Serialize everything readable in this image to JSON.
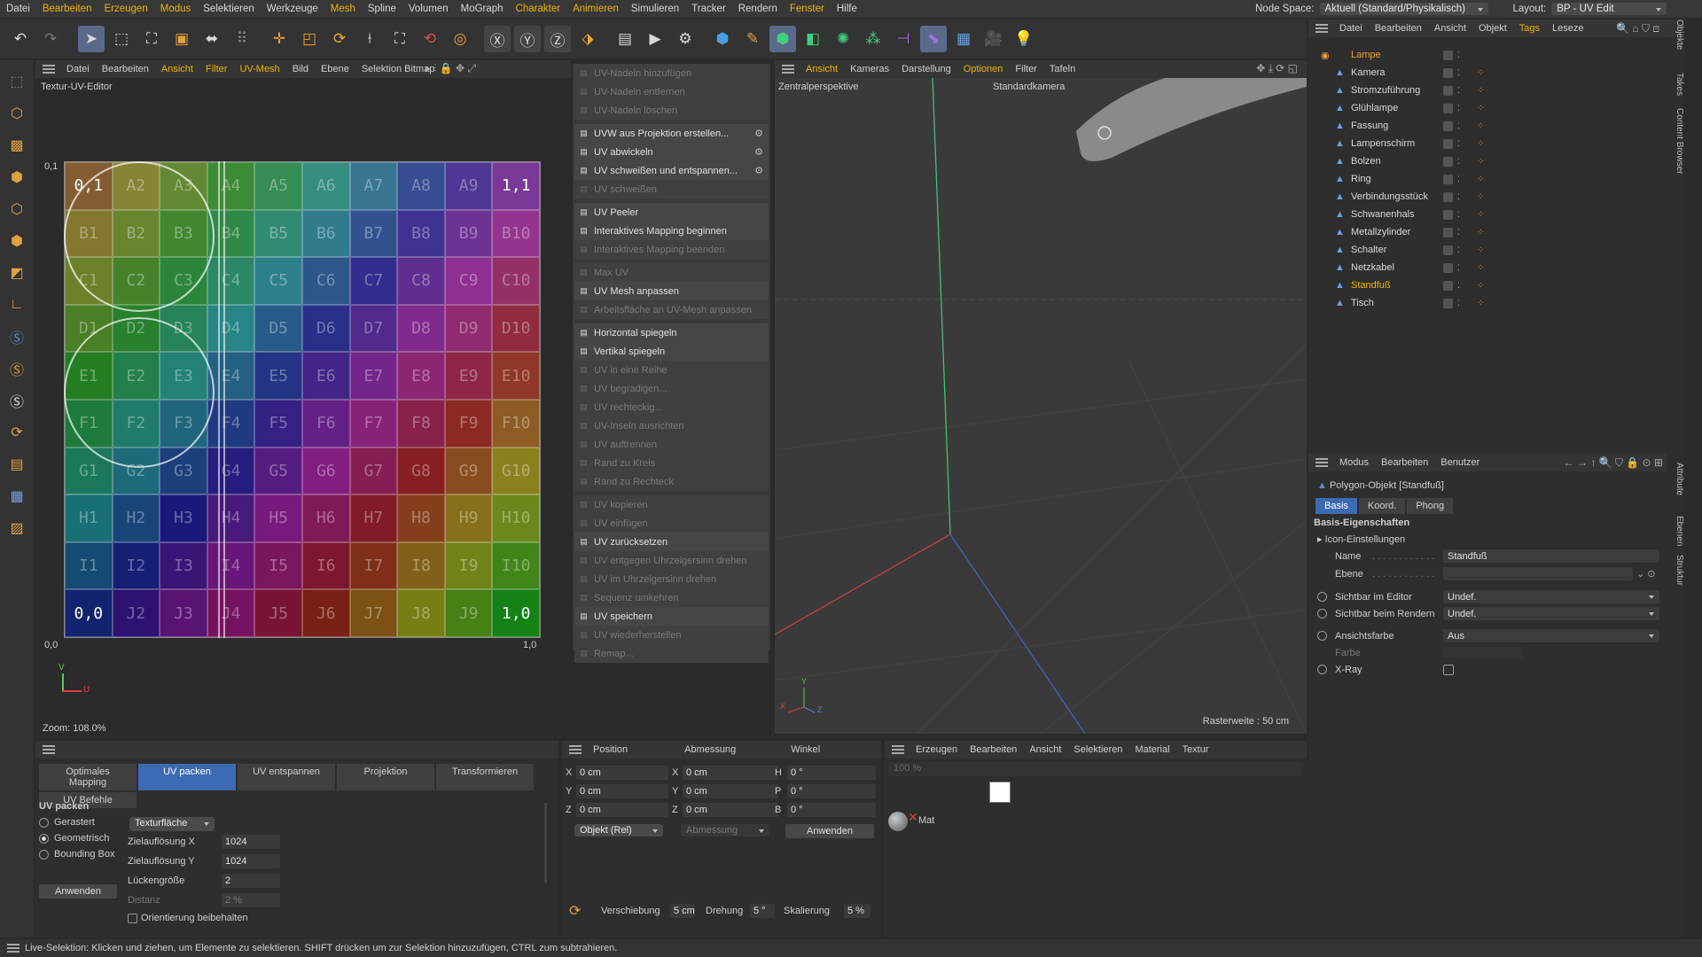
{
  "menubar": {
    "items": [
      "Datei",
      "Bearbeiten",
      "Erzeugen",
      "Modus",
      "Selektieren",
      "Werkzeuge",
      "Mesh",
      "Spline",
      "Volumen",
      "MoGraph",
      "Charakter",
      "Animieren",
      "Simulieren",
      "Tracker",
      "Rendern",
      "Fenster",
      "Hilfe"
    ],
    "highlight": [
      "Bearbeiten",
      "Erzeugen",
      "Modus",
      "Mesh",
      "Charakter",
      "Animieren",
      "Fenster"
    ],
    "node_space_label": "Node Space:",
    "node_space_value": "Aktuell (Standard/Physikalisch)",
    "layout_label": "Layout:",
    "layout_value": "BP - UV Edit"
  },
  "uv_editor": {
    "menu": [
      "Datei",
      "Bearbeiten",
      "Ansicht",
      "Filter",
      "UV-Mesh",
      "Bild",
      "Ebene",
      "Selektion Bitmap"
    ],
    "menu_hl": [
      "Ansicht",
      "Filter",
      "UV-Mesh"
    ],
    "title": "Textur-UV-Editor",
    "corner_tl": "0,1",
    "corner_bl": "0,0",
    "corner_br": "1,0",
    "corner_tr": "1,1",
    "zoom": "Zoom: 108.0%",
    "cells": [
      "0,1",
      "A2",
      "A3",
      "A4",
      "A5",
      "A6",
      "A7",
      "A8",
      "A9",
      "1,1",
      "B1",
      "B2",
      "B3",
      "B4",
      "B5",
      "B6",
      "B7",
      "B8",
      "B9",
      "B10",
      "C1",
      "C2",
      "C3",
      "C4",
      "C5",
      "C6",
      "C7",
      "C8",
      "C9",
      "C10",
      "D1",
      "D2",
      "D3",
      "D4",
      "D5",
      "D6",
      "D7",
      "D8",
      "D9",
      "D10",
      "E1",
      "E2",
      "E3",
      "E4",
      "E5",
      "E6",
      "E7",
      "E8",
      "E9",
      "E10",
      "F1",
      "F2",
      "F3",
      "F4",
      "F5",
      "F6",
      "F7",
      "F8",
      "F9",
      "F10",
      "G1",
      "G2",
      "G3",
      "G4",
      "G5",
      "G6",
      "G7",
      "G8",
      "G9",
      "G10",
      "H1",
      "H2",
      "H3",
      "H4",
      "H5",
      "H6",
      "H7",
      "H8",
      "H9",
      "H10",
      "I1",
      "I2",
      "I3",
      "I4",
      "I5",
      "I6",
      "I7",
      "I8",
      "I9",
      "I10",
      "0,0",
      "J2",
      "J3",
      "J4",
      "J5",
      "J6",
      "J7",
      "J8",
      "J9",
      "1,0"
    ]
  },
  "uv_commands": [
    {
      "label": "UV-Nadeln hinzufügen",
      "dis": true
    },
    {
      "label": "UV-Nadeln entfernen",
      "dis": true
    },
    {
      "label": "UV-Nadeln löschen",
      "dis": true
    },
    {
      "sep": true
    },
    {
      "label": "UVW aus Projektion erstellen...",
      "dis": false,
      "gear": true
    },
    {
      "label": "UV abwickeln",
      "dis": false,
      "gear": true
    },
    {
      "label": "UV schweißen und entspannen...",
      "dis": false,
      "gear": true
    },
    {
      "label": "UV schweißen",
      "dis": true
    },
    {
      "sep": true
    },
    {
      "label": "UV Peeler",
      "dis": false
    },
    {
      "label": "Interaktives Mapping beginnen",
      "dis": false
    },
    {
      "label": "Interaktives Mapping beenden",
      "dis": true
    },
    {
      "sep": true
    },
    {
      "label": "Max UV",
      "dis": true
    },
    {
      "label": "UV Mesh anpassen",
      "dis": false
    },
    {
      "label": "Arbeitsfläche an UV-Mesh anpassen",
      "dis": true
    },
    {
      "sep": true
    },
    {
      "label": "Horizontal spiegeln",
      "dis": false
    },
    {
      "label": "Vertikal spiegeln",
      "dis": false
    },
    {
      "label": "UV in eine Reihe",
      "dis": true
    },
    {
      "label": "UV begradigen...",
      "dis": true
    },
    {
      "label": "UV rechteckig...",
      "dis": true
    },
    {
      "label": "UV-Inseln ausrichten",
      "dis": true
    },
    {
      "label": "UV auftrennen",
      "dis": true
    },
    {
      "label": "Rand zu Kreis",
      "dis": true
    },
    {
      "label": "Rand zu Rechteck",
      "dis": true
    },
    {
      "sep": true
    },
    {
      "label": "UV kopieren",
      "dis": true
    },
    {
      "label": "UV einfügen",
      "dis": true
    },
    {
      "label": "UV zurücksetzen",
      "dis": false
    },
    {
      "label": "UV entgegen Uhrzeigersinn drehen",
      "dis": true
    },
    {
      "label": "UV im Uhrzeigersinn drehen",
      "dis": true
    },
    {
      "label": "Sequenz umkehren",
      "dis": true
    },
    {
      "label": "UV speichern",
      "dis": false
    },
    {
      "label": "UV wiederherstellen",
      "dis": true
    },
    {
      "label": "Remap...",
      "dis": true
    }
  ],
  "viewport": {
    "menu": [
      "Ansicht",
      "Kameras",
      "Darstellung",
      "Optionen",
      "Filter",
      "Tafeln"
    ],
    "menu_hl": [
      "Ansicht",
      "Optionen"
    ],
    "perspective": "Zentralperspektive",
    "camera": "Standardkamera",
    "grid": "Rasterweite : 50 cm",
    "axis_x": "X",
    "axis_y": "Y",
    "axis_z": "Z"
  },
  "objects": {
    "menu": [
      "Datei",
      "Bearbeiten",
      "Ansicht",
      "Objekt",
      "Tags",
      "Leseze"
    ],
    "items": [
      {
        "name": "Lampe",
        "color": "#f0a030",
        "indent": 0
      },
      {
        "name": "Kamera",
        "color": "#d8d8d8",
        "indent": 1
      },
      {
        "name": "Stromzuführung",
        "color": "#d8d8d8",
        "indent": 1
      },
      {
        "name": "Glühlampe",
        "color": "#d8d8d8",
        "indent": 1
      },
      {
        "name": "Fassung",
        "color": "#d8d8d8",
        "indent": 1
      },
      {
        "name": "Lampenschirm",
        "color": "#d8d8d8",
        "indent": 1
      },
      {
        "name": "Bolzen",
        "color": "#d8d8d8",
        "indent": 1
      },
      {
        "name": "Ring",
        "color": "#d8d8d8",
        "indent": 1
      },
      {
        "name": "Verbindungsstück",
        "color": "#d8d8d8",
        "indent": 1
      },
      {
        "name": "Schwanenhals",
        "color": "#d8d8d8",
        "indent": 1
      },
      {
        "name": "Metallzylinder",
        "color": "#d8d8d8",
        "indent": 1
      },
      {
        "name": "Schalter",
        "color": "#d8d8d8",
        "indent": 1
      },
      {
        "name": "Netzkabel",
        "color": "#d8d8d8",
        "indent": 1
      },
      {
        "name": "Standfuß",
        "color": "#f0b400",
        "indent": 1
      },
      {
        "name": "Tisch",
        "color": "#d8d8d8",
        "indent": 1
      }
    ]
  },
  "side_tabs": {
    "top": [
      "Objekte",
      "Takes",
      "Content Browser"
    ],
    "bottom": [
      "Attribute",
      "Ebenen",
      "Struktur"
    ]
  },
  "attributes": {
    "menu": [
      "Modus",
      "Bearbeiten",
      "Benutzer"
    ],
    "object": "Polygon-Objekt [Standfuß]",
    "tabs": [
      "Basis",
      "Koord.",
      "Phong"
    ],
    "section": "Basis-Eigenschaften",
    "icon_settings": "Icon-Einstellungen",
    "name_label": "Name",
    "name_value": "Standfuß",
    "ebene_label": "Ebene",
    "editor_label": "Sichtbar im Editor",
    "editor_value": "Undef.",
    "render_label": "Sichtbar beim Rendern",
    "render_value": "Undef.",
    "color_label": "Ansichtsfarbe",
    "color_value": "Aus",
    "farbe_label": "Farbe",
    "xray_label": "X-Ray"
  },
  "uv_tools": {
    "tabs": [
      "Optimales Mapping",
      "UV packen",
      "UV entspannen",
      "Projektion",
      "Transformieren",
      "UV Befehle"
    ],
    "active": "UV packen",
    "section": "UV packen",
    "opt1": "Gerastert",
    "opt2": "Geometrisch",
    "opt3": "Bounding Box",
    "method": "Texturfläche",
    "res_x_label": "Zielauflösung X",
    "res_x": "1024",
    "res_y_label": "Zielauflösung Y",
    "res_y": "1024",
    "gap_label": "Lückengröße",
    "gap": "2",
    "dist_label": "Distanz",
    "dist": "2 %",
    "orient_label": "Orientierung beibehalten",
    "apply": "Anwenden"
  },
  "coords": {
    "h_pos": "Position",
    "h_size": "Abmessung",
    "h_rot": "Winkel",
    "x": "0 cm",
    "y": "0 cm",
    "z": "0 cm",
    "sx": "0 cm",
    "sy": "0 cm",
    "sz": "0 cm",
    "h": "0 °",
    "p": "0 °",
    "b": "0 °",
    "mode": "Objekt (Rel)",
    "size_mode": "Abmessung",
    "apply": "Anwenden",
    "shift_label": "Verschiebung",
    "shift": "5 cm",
    "rot_label": "Drehung",
    "rot": "5 °",
    "scale_label": "Skalierung",
    "scale": "5 %"
  },
  "materials": {
    "menu": [
      "Erzeugen",
      "Bearbeiten",
      "Ansicht",
      "Selektieren",
      "Material",
      "Textur"
    ],
    "zoom": "100 %",
    "mat": "Mat"
  },
  "status": "Live-Selektion: Klicken und ziehen, um Elemente zu selektieren. SHIFT drücken um zur Selektion hinzuzufügen, CTRL zum subtrahieren."
}
